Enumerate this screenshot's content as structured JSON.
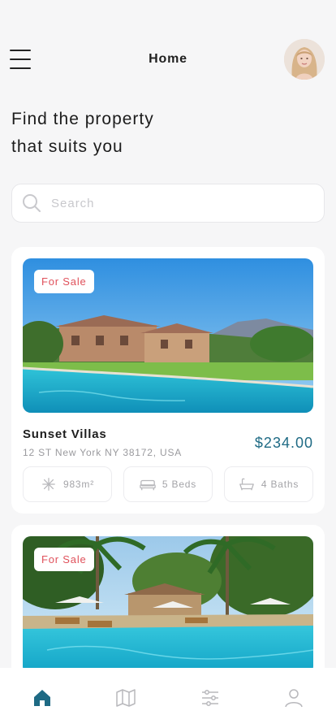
{
  "header": {
    "title": "Home",
    "menu_icon": "menu-icon",
    "avatar_icon": "avatar"
  },
  "hero": {
    "line1": "Find the property",
    "line2": "that suits you"
  },
  "search": {
    "placeholder": "Search",
    "value": "",
    "icon": "search-icon"
  },
  "properties": [
    {
      "badge": "For Sale",
      "name": "Sunset Villas",
      "address": "12 ST New York NY 38172, USA",
      "price": "$234.00",
      "area": "983m²",
      "beds": "5 Beds",
      "baths": "4 Baths"
    },
    {
      "badge": "For Sale"
    }
  ],
  "tabbar": {
    "active": "home",
    "items": [
      "home-icon",
      "map-icon",
      "filter-icon",
      "profile-icon"
    ]
  },
  "colors": {
    "accent": "#1e6a84",
    "badge_text": "#e0525c",
    "background": "#f6f6f7"
  }
}
